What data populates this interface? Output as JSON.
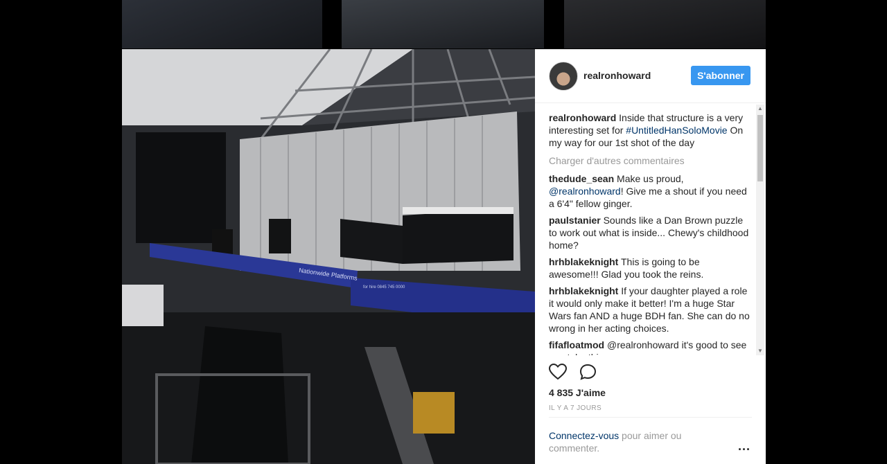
{
  "post": {
    "username": "realronhoward",
    "follow_label": "S'abonner",
    "caption": {
      "user": "realronhoward",
      "text_before": "Inside that structure is a very interesting set for",
      "hashtag": "#UntitledHanSoloMovie",
      "text_after": "On my way for our 1st shot of the day"
    },
    "load_more_label": "Charger d'autres commentaires",
    "comments": [
      {
        "user": "thedude_sean",
        "text_before": "Make us proud,",
        "mention": "@realronhoward",
        "text_after": "! Give me a shout if you need a 6'4\" fellow ginger."
      },
      {
        "user": "paulstanier",
        "text": "Sounds like a Dan Brown puzzle to work out what is inside... Chewy's childhood home?"
      },
      {
        "user": "hrhblakeknight",
        "text": "This is going to be awesome!!! Glad you took the reins."
      },
      {
        "user": "hrhblakeknight",
        "text": "If your daughter played a role it would only make it better! I'm a huge Star Wars fan AND a huge BDH fan. She can do no wrong in her acting choices."
      },
      {
        "user": "fifafloatmod",
        "text": "@realronhoward it's good to see you take this on"
      }
    ],
    "likes_label": "4 835 J'aime",
    "time_label": "IL Y A 7 JOURS",
    "footer": {
      "login_link": "Connectez-vous",
      "login_text": " pour aimer ou commenter."
    }
  },
  "photo": {
    "banner_text": "Nationwide Platforms",
    "phone_text": "for hire 0845 745 0000"
  },
  "icons": {
    "like": "heart-outline-icon",
    "comment": "speech-bubble-icon",
    "more": "ellipsis-icon"
  },
  "colors": {
    "accent": "#3897f0",
    "link": "#003569",
    "muted": "#999999"
  }
}
